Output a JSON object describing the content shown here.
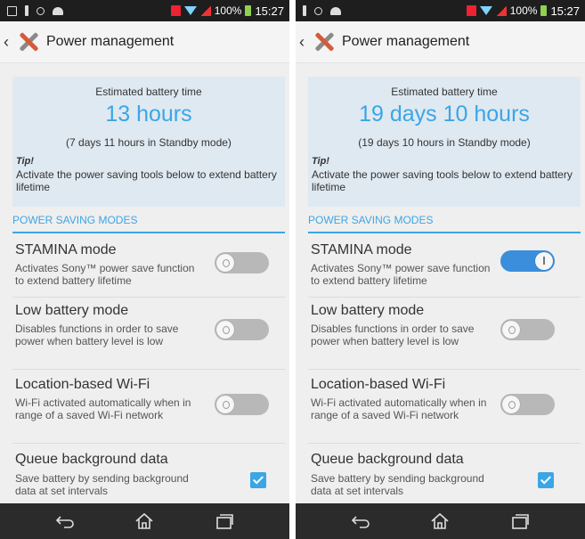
{
  "screens": [
    {
      "status": {
        "battery_pct": "100%",
        "time": "15:27"
      },
      "header": {
        "title": "Power management"
      },
      "battery": {
        "label": "Estimated battery time",
        "hours": "13 hours",
        "standby": "(7 days 11 hours in Standby mode)",
        "tip_label": "Tip!",
        "tip_text": "Activate the power saving tools below to extend battery lifetime"
      },
      "section": "POWER SAVING MODES",
      "modes": [
        {
          "title": "STAMINA mode",
          "desc": "Activates Sony™ power save function to extend battery lifetime",
          "on": false
        },
        {
          "title": "Low battery mode",
          "desc": "Disables functions in order to save power when battery level is low",
          "on": false
        },
        {
          "title": "Location-based Wi-Fi",
          "desc": "Wi-Fi activated automatically when in range of a saved Wi-Fi network",
          "on": false
        },
        {
          "title": "Queue background data",
          "desc": "Save battery by sending background data at set intervals",
          "checked": true
        }
      ]
    },
    {
      "status": {
        "battery_pct": "100%",
        "time": "15:27"
      },
      "header": {
        "title": "Power management"
      },
      "battery": {
        "label": "Estimated battery time",
        "hours": "19 days 10 hours",
        "standby": "(19 days 10 hours in Standby mode)",
        "tip_label": "Tip!",
        "tip_text": "Activate the power saving tools below to extend battery lifetime"
      },
      "section": "POWER SAVING MODES",
      "modes": [
        {
          "title": "STAMINA mode",
          "desc": "Activates Sony™ power save function to extend battery lifetime",
          "on": true
        },
        {
          "title": "Low battery mode",
          "desc": "Disables functions in order to save power when battery level is low",
          "on": false
        },
        {
          "title": "Location-based Wi-Fi",
          "desc": "Wi-Fi activated automatically when in range of a saved Wi-Fi network",
          "on": false
        },
        {
          "title": "Queue background data",
          "desc": "Save battery by sending background data at set intervals",
          "checked": true
        }
      ]
    }
  ],
  "colors": {
    "accent": "#3aa6e6",
    "toggle_on": "#3a8edc",
    "toggle_off": "#b8b8b8",
    "navbar": "#2b2b2b",
    "statusbar": "#1e1e1e"
  },
  "icons": {
    "back": "chevron-left-icon",
    "app": "tools-icon",
    "nav": [
      "back-icon",
      "home-icon",
      "recent-apps-icon"
    ]
  }
}
